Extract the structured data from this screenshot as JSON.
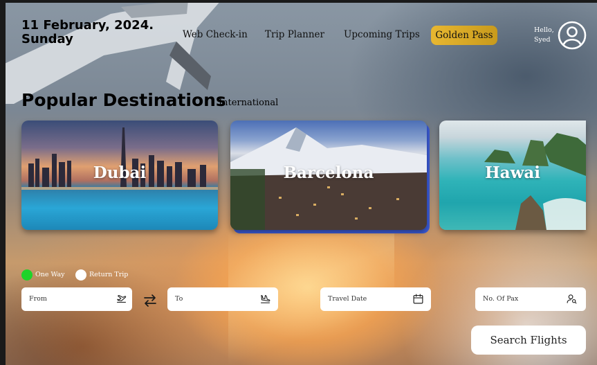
{
  "header": {
    "date_line1": "11 February, 2024.",
    "date_line2": "Sunday",
    "nav": [
      {
        "label": "Web Check-in"
      },
      {
        "label": "Trip Planner"
      },
      {
        "label": "Upcoming Trips"
      },
      {
        "label": "Golden Pass"
      }
    ],
    "greeting_line1": "Hello,",
    "greeting_line2": "Syed",
    "avatar_icon": "user-circle-icon"
  },
  "destinations": {
    "title": "Popular Destinations",
    "subtitle": "International",
    "cards": [
      {
        "label": "Dubai"
      },
      {
        "label": "Barcelona"
      },
      {
        "label": "Hawai"
      }
    ]
  },
  "booking": {
    "trip_types": [
      {
        "label": "One Way",
        "selected": true
      },
      {
        "label": "Return Trip",
        "selected": false
      }
    ],
    "from_placeholder": "From",
    "to_placeholder": "To",
    "date_placeholder": "Travel Date",
    "pax_placeholder": "No. Of Pax",
    "search_label": "Search Flights"
  },
  "colors": {
    "golden_pass": "#e0ae2a",
    "one_way_selected": "#1fd32a",
    "return_unselected": "#ffffff",
    "barcelona_accent": "#3b5bd6"
  },
  "icons": {
    "from": "plane-takeoff-icon",
    "to": "plane-landing-icon",
    "swap": "swap-arrows-icon",
    "date": "calendar-icon",
    "pax": "person-search-icon"
  }
}
